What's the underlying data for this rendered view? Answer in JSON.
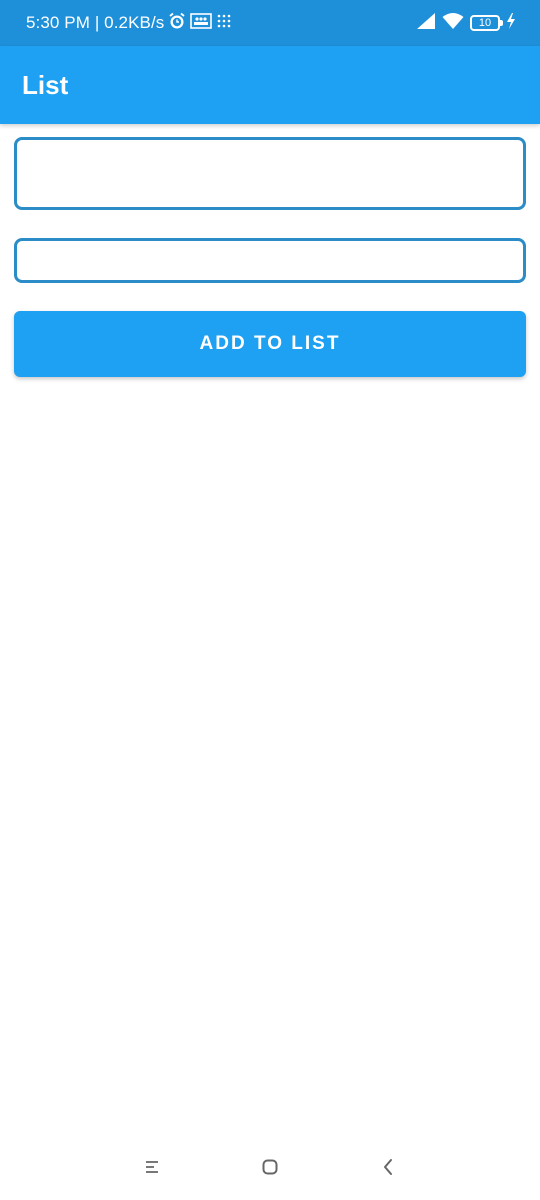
{
  "status_bar": {
    "time_text": "5:30 PM | 0.2KB/s",
    "battery_level": "10",
    "icons": [
      "alarm-icon",
      "photo-icon",
      "grid-dots-icon",
      "signal-icon",
      "wifi-icon",
      "battery-icon",
      "charging-icon"
    ]
  },
  "app_bar": {
    "title": "List"
  },
  "form": {
    "field1_value": "",
    "field2_value": "",
    "add_button_label": "ADD TO LIST"
  },
  "nav_bar": {
    "icons": [
      "menu-icon",
      "home-icon",
      "back-icon"
    ]
  },
  "colors": {
    "status_bar": "#1e8fd9",
    "app_bar": "#1ea1f2",
    "field_border": "#2b8cc8",
    "button": "#1ea1f2"
  }
}
